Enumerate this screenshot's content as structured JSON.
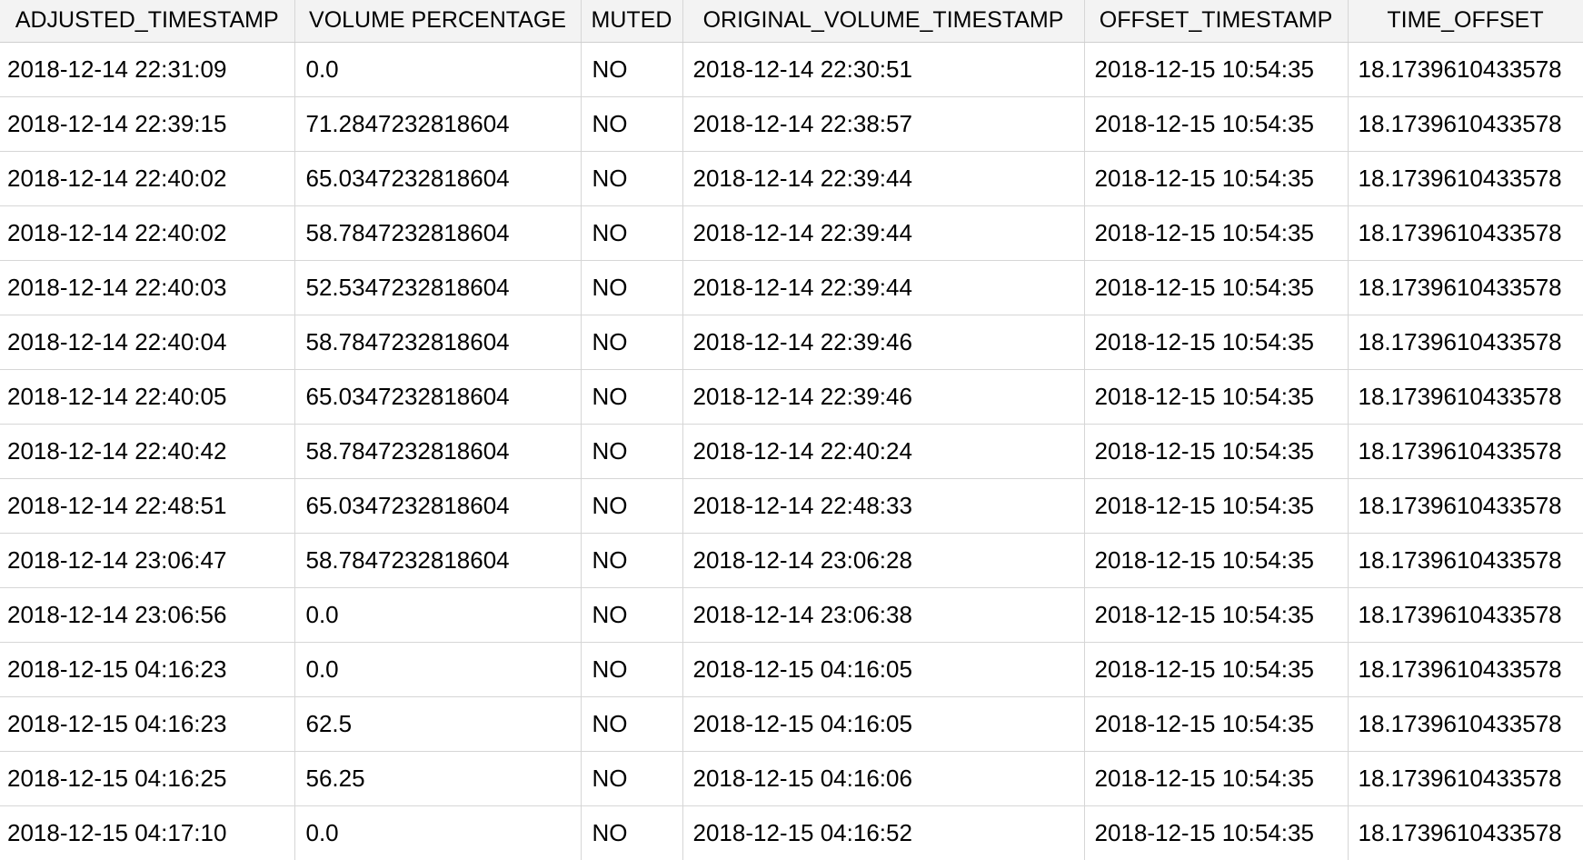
{
  "table": {
    "columns": [
      "ADJUSTED_TIMESTAMP",
      "VOLUME PERCENTAGE",
      "MUTED",
      "ORIGINAL_VOLUME_TIMESTAMP",
      "OFFSET_TIMESTAMP",
      "TIME_OFFSET"
    ],
    "rows": [
      [
        "2018-12-14 22:31:09",
        "0.0",
        "NO",
        "2018-12-14 22:30:51",
        "2018-12-15 10:54:35",
        "18.1739610433578"
      ],
      [
        "2018-12-14 22:39:15",
        "71.2847232818604",
        "NO",
        "2018-12-14 22:38:57",
        "2018-12-15 10:54:35",
        "18.1739610433578"
      ],
      [
        "2018-12-14 22:40:02",
        "65.0347232818604",
        "NO",
        "2018-12-14 22:39:44",
        "2018-12-15 10:54:35",
        "18.1739610433578"
      ],
      [
        "2018-12-14 22:40:02",
        "58.7847232818604",
        "NO",
        "2018-12-14 22:39:44",
        "2018-12-15 10:54:35",
        "18.1739610433578"
      ],
      [
        "2018-12-14 22:40:03",
        "52.5347232818604",
        "NO",
        "2018-12-14 22:39:44",
        "2018-12-15 10:54:35",
        "18.1739610433578"
      ],
      [
        "2018-12-14 22:40:04",
        "58.7847232818604",
        "NO",
        "2018-12-14 22:39:46",
        "2018-12-15 10:54:35",
        "18.1739610433578"
      ],
      [
        "2018-12-14 22:40:05",
        "65.0347232818604",
        "NO",
        "2018-12-14 22:39:46",
        "2018-12-15 10:54:35",
        "18.1739610433578"
      ],
      [
        "2018-12-14 22:40:42",
        "58.7847232818604",
        "NO",
        "2018-12-14 22:40:24",
        "2018-12-15 10:54:35",
        "18.1739610433578"
      ],
      [
        "2018-12-14 22:48:51",
        "65.0347232818604",
        "NO",
        "2018-12-14 22:48:33",
        "2018-12-15 10:54:35",
        "18.1739610433578"
      ],
      [
        "2018-12-14 23:06:47",
        "58.7847232818604",
        "NO",
        "2018-12-14 23:06:28",
        "2018-12-15 10:54:35",
        "18.1739610433578"
      ],
      [
        "2018-12-14 23:06:56",
        "0.0",
        "NO",
        "2018-12-14 23:06:38",
        "2018-12-15 10:54:35",
        "18.1739610433578"
      ],
      [
        "2018-12-15 04:16:23",
        "0.0",
        "NO",
        "2018-12-15 04:16:05",
        "2018-12-15 10:54:35",
        "18.1739610433578"
      ],
      [
        "2018-12-15 04:16:23",
        "62.5",
        "NO",
        "2018-12-15 04:16:05",
        "2018-12-15 10:54:35",
        "18.1739610433578"
      ],
      [
        "2018-12-15 04:16:25",
        "56.25",
        "NO",
        "2018-12-15 04:16:06",
        "2018-12-15 10:54:35",
        "18.1739610433578"
      ],
      [
        "2018-12-15 04:17:10",
        "0.0",
        "NO",
        "2018-12-15 04:16:52",
        "2018-12-15 10:54:35",
        "18.1739610433578"
      ]
    ]
  }
}
